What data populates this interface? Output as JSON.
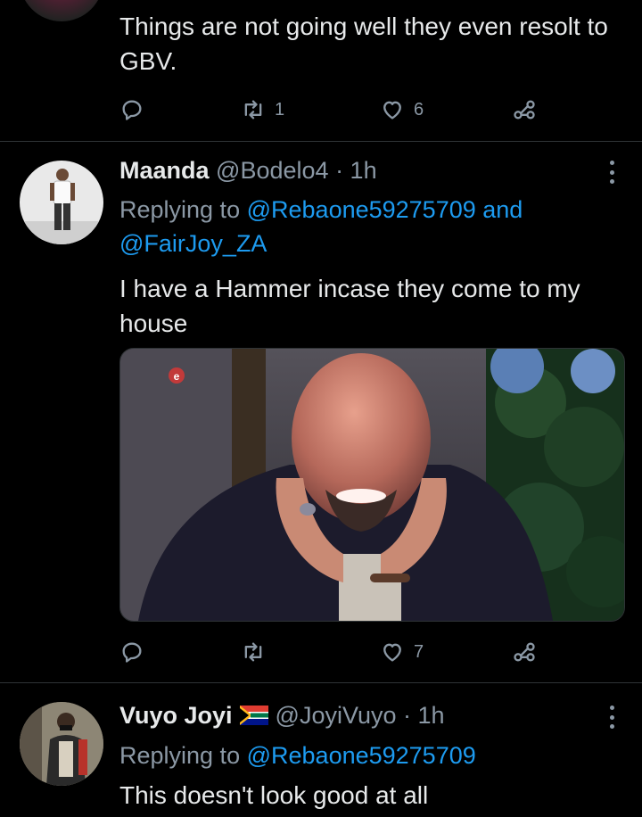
{
  "tweets": [
    {
      "text": "Things are not going well they even resolt to GBV.",
      "retweets": "1",
      "likes": "6"
    },
    {
      "name": "Maanda",
      "handle": "@Bodelo4",
      "time": "· 1h",
      "replying_prefix": "Replying to",
      "replying_to": [
        "@Rebaone59275709",
        "@FairJoy_ZA"
      ],
      "replying_joiner": "and",
      "text": "I have a Hammer incase they come to my house",
      "media_badge": "e",
      "retweets": "",
      "likes": "7"
    },
    {
      "name": "Vuyo Joyi",
      "handle": "@JoyiVuyo",
      "time": "· 1h",
      "replying_prefix": "Replying to",
      "replying_to": [
        "@Rebaone59275709"
      ],
      "text": "This doesn't look good at all"
    }
  ],
  "colors": {
    "background": "#000000",
    "primary_text": "#e7e9ea",
    "secondary_text": "#8b98a5",
    "link": "#1d9bf0",
    "divider": "#2f3336"
  },
  "icons": [
    "reply-icon",
    "retweet-icon",
    "like-icon",
    "share-icon",
    "more-icon",
    "south-africa-flag-icon"
  ]
}
